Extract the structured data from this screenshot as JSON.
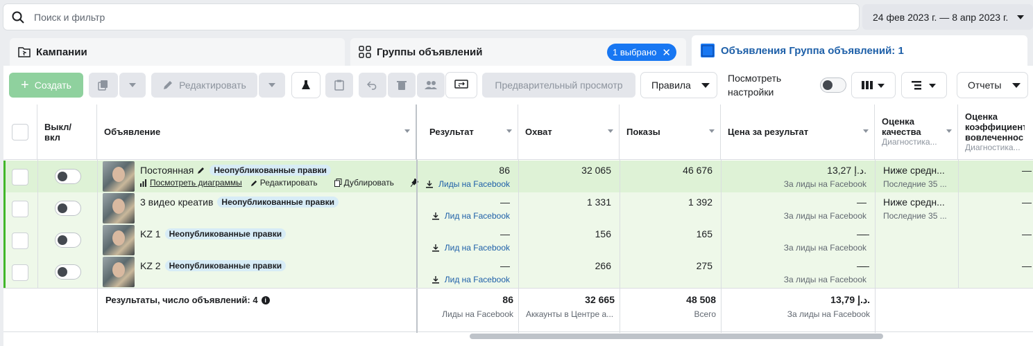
{
  "search": {
    "placeholder": "Поиск и фильтр"
  },
  "date_range": "24 фев 2023 г. — 8 апр 2023 г.",
  "tabs": [
    {
      "label": "Кампании"
    },
    {
      "label": "Группы объявлений",
      "badge": "1 выбрано"
    },
    {
      "label": "Объявления Группа объявлений: 1"
    }
  ],
  "toolbar": {
    "create": "Создать",
    "edit": "Редактировать",
    "preview": "Предварительный просмотр",
    "rules": "Правила",
    "view_settings": "Посмотреть настройки",
    "reports": "Отчеты"
  },
  "columns": {
    "toggle": "Выкл/ вкл",
    "ad": "Объявление",
    "result": "Результат",
    "reach": "Охват",
    "impressions": "Показы",
    "cost": "Цена за результат",
    "quality": "Оценка качества",
    "quality_sub": "Диагностика...",
    "engagement": "Оценка коэффициент вовлеченнос",
    "engagement_sub": "Диагностика..."
  },
  "rows": [
    {
      "name": "Постоянная",
      "badge": "Неопубликованные правки",
      "result": "86",
      "result_sub": "Лиды на Facebook",
      "reach": "32 065",
      "impressions": "46 676",
      "cost": "13,27 د.إ.",
      "cost_sub": "За лиды на Facebook",
      "quality": "Ниже средн...",
      "quality_sub": "Последние 35 ...",
      "engagement": "—"
    },
    {
      "name": "3 видео креатив",
      "badge": "Неопубликованные правки",
      "result": "—",
      "result_sub": "Лид на Facebook",
      "reach": "1 331",
      "impressions": "1 392",
      "cost": "—",
      "cost_sub": "За лиды на Facebook",
      "quality": "Ниже средн...",
      "quality_sub": "Последние 35 ...",
      "engagement": "—"
    },
    {
      "name": "KZ 1",
      "badge": "Неопубликованные правки",
      "result": "—",
      "result_sub": "Лид на Facebook",
      "reach": "156",
      "impressions": "165",
      "cost": "—",
      "cost_sub": "За лиды на Facebook",
      "quality": "—",
      "quality_sub": "",
      "engagement": "—"
    },
    {
      "name": "KZ 2",
      "badge": "Неопубликованные правки",
      "result": "—",
      "result_sub": "Лид на Facebook",
      "reach": "266",
      "impressions": "275",
      "cost": "—",
      "cost_sub": "За лиды на Facebook",
      "quality": "—",
      "quality_sub": "",
      "engagement": "—"
    }
  ],
  "row_actions": {
    "charts": "Посмотреть диаграммы",
    "edit": "Редактировать",
    "duplicate": "Дублировать"
  },
  "totals": {
    "label": "Результаты, число объявлений: 4",
    "result": "86",
    "result_sub": "Лиды на Facebook",
    "reach": "32 665",
    "reach_sub": "Аккаунты в Центре а...",
    "impressions": "48 508",
    "impressions_sub": "Всего",
    "cost": "13,79 د.إ.",
    "cost_sub": "За лиды на Facebook"
  }
}
